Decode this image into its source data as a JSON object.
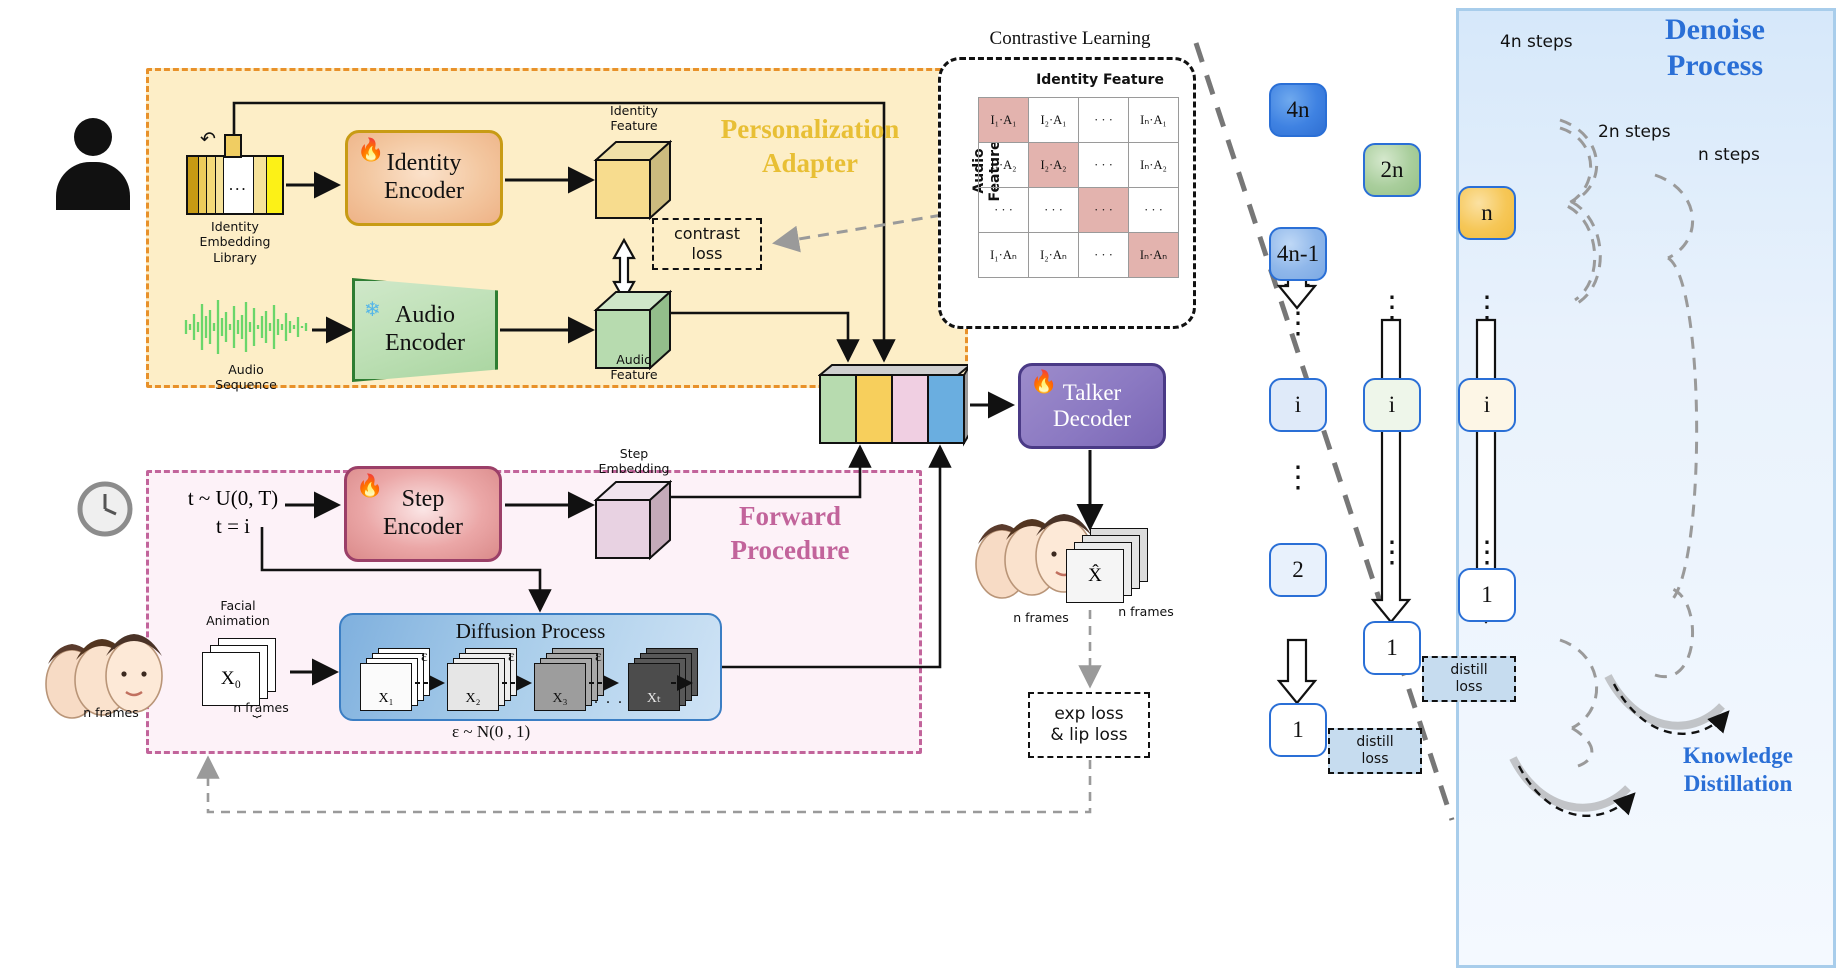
{
  "personalization_adapter": {
    "title": "Personalization\nAdapter",
    "title_line1": "Personalization",
    "title_line2": "Adapter",
    "identity_library_caption": "Identity\nEmbedding\nLibrary",
    "identity_library_line1": "Identity",
    "identity_library_line2": "Embedding",
    "identity_library_line3": "Library",
    "identity_encoder_line1": "Identity",
    "identity_encoder_line2": "Encoder",
    "identity_encoder_badge": "fire-icon",
    "audio_encoder_line1": "Audio",
    "audio_encoder_line2": "Encoder",
    "audio_encoder_badge": "snowflake-icon",
    "audio_sequence_line1": "Audio",
    "audio_sequence_line2": "Sequence",
    "identity_feature_line1": "Identity",
    "identity_feature_line2": "Feature",
    "audio_feature_line1": "Audio",
    "audio_feature_line2": "Feature",
    "contrast_loss_line1": "contrast",
    "contrast_loss_line2": "loss"
  },
  "contrastive_learning": {
    "heading": "Contrastive Learning",
    "col_axis_label": "Identity Feature",
    "row_axis_label": "Audio Feature",
    "matrix": [
      [
        {
          "t": "I₁·A₁",
          "hl": true
        },
        {
          "t": "I₂·A₁",
          "hl": false
        },
        {
          "t": "· · ·",
          "hl": false
        },
        {
          "t": "Iₙ·A₁",
          "hl": false
        }
      ],
      [
        {
          "t": "I₁·A₂",
          "hl": false
        },
        {
          "t": "I₂·A₂",
          "hl": true
        },
        {
          "t": "· · ·",
          "hl": false
        },
        {
          "t": "Iₙ·A₂",
          "hl": false
        }
      ],
      [
        {
          "t": "· · ·",
          "hl": false
        },
        {
          "t": "· · ·",
          "hl": false
        },
        {
          "t": "· · ·",
          "hl": true
        },
        {
          "t": "· · ·",
          "hl": false
        }
      ],
      [
        {
          "t": "I₁·Aₙ",
          "hl": false
        },
        {
          "t": "I₂·Aₙ",
          "hl": false
        },
        {
          "t": "· · ·",
          "hl": false
        },
        {
          "t": "Iₙ·Aₙ",
          "hl": true
        }
      ]
    ]
  },
  "forward_procedure": {
    "title_line1": "Forward",
    "title_line2": "Procedure",
    "t_dist_line1": "t ~ U(0, T)",
    "t_dist_line2": "t = i",
    "step_encoder_line1": "Step",
    "step_encoder_line2": "Encoder",
    "step_encoder_badge": "fire-icon",
    "step_embedding_line1": "Step",
    "step_embedding_line2": "Embedding",
    "facial_animation_line1": "Facial",
    "facial_animation_line2": "Animation",
    "x0_label": "X₀",
    "x0_frames_caption": "n frames",
    "input_frames_caption": "n frames",
    "diffusion_title": "Diffusion Process",
    "diffusion_steps": [
      "X₁",
      "X₂",
      "X₃",
      "Xₜ"
    ],
    "noise_labels": [
      "ε",
      "ε",
      "ε"
    ],
    "ellipsis": ". . .",
    "noise_dist": "ε ~ N(0 , 1)"
  },
  "decoder": {
    "talker_line1": "Talker",
    "talker_line2": "Decoder",
    "talker_badge": "fire-icon"
  },
  "outputs": {
    "gt_frames_caption": "n frames",
    "pred_label": "X̂",
    "pred_frames_caption": "n frames",
    "exp_loss_line1": "exp loss",
    "exp_loss_line2": "& lip loss"
  },
  "denoise_process": {
    "title_line1": "Denoise",
    "title_line2": "Process",
    "columns": [
      {
        "steps_label": "4n steps",
        "nodes": [
          "4n",
          "4n-1",
          "2",
          "1"
        ]
      },
      {
        "steps_label": "2n steps",
        "nodes": [
          "2n",
          "i",
          "1"
        ]
      },
      {
        "steps_label": "n steps",
        "nodes": [
          "n",
          "i",
          "1"
        ]
      }
    ],
    "col1_nodes": [
      "4n",
      "4n-1",
      "i",
      "2",
      "1"
    ],
    "col2_nodes": [
      "2n",
      "i",
      "1"
    ],
    "col3_nodes": [
      "n",
      "i",
      "1"
    ],
    "distill_loss_line1": "distill",
    "distill_loss_line2": "loss",
    "knowledge_distillation_line1": "Knowledge",
    "knowledge_distillation_line2": "Distillation",
    "vertical_dots": "⋮"
  },
  "colors": {
    "adapter_fill": "#fdeec7",
    "adapter_border": "#e8912a",
    "adapter_title": "#e8bf35",
    "forward_fill": "#fdf2f8",
    "forward_border": "#c2649b",
    "forward_title": "#c2649b",
    "denoise_fill": "#d6e8fa",
    "denoise_title": "#2a6fd6",
    "identity_cube": "#f7dc8e",
    "audio_cube": "#b7dbaf",
    "step_cube": "#e8d2e2",
    "concat_blue": "#7fb5e2",
    "highlight_cell": "#e3b3ae",
    "talker_purple": "#8b79c2"
  }
}
